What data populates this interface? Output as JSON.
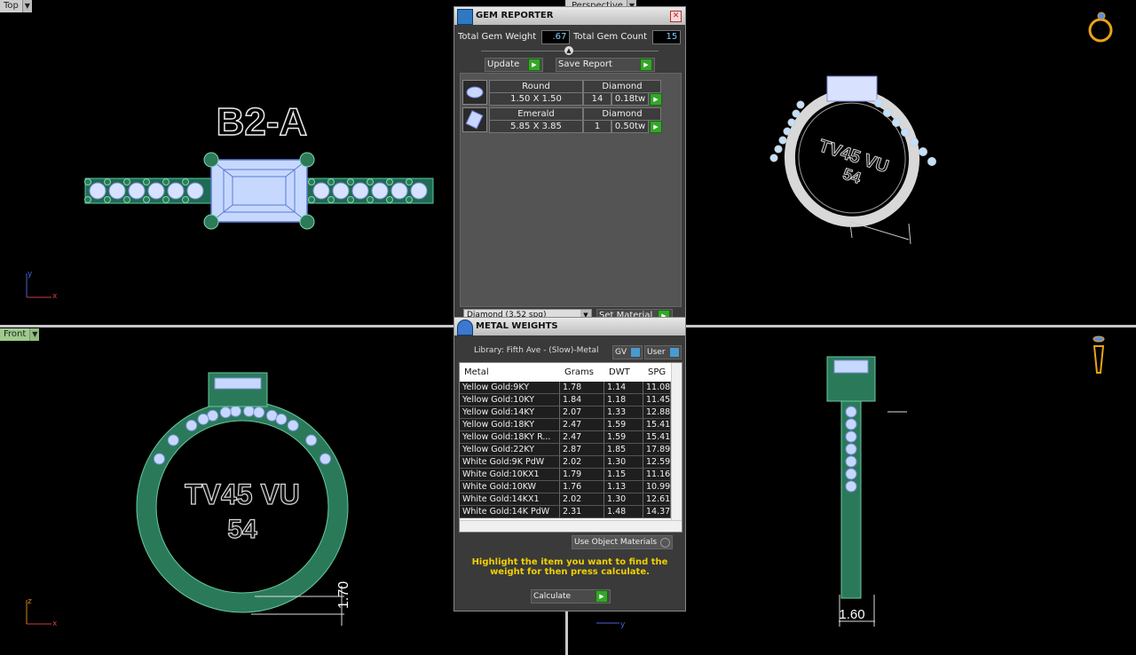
{
  "viewports": {
    "top": {
      "label": "Top",
      "ring_text": "B2-A"
    },
    "perspective": {
      "label": "Perspective",
      "inscription_1": "TV45 VU",
      "inscription_2": "54"
    },
    "front": {
      "label": "Front",
      "inscription_1": "TV45 VU",
      "inscription_2": "54",
      "dimension": "1.70"
    },
    "right": {
      "dimension": "1.60"
    }
  },
  "axis": {
    "x": "x",
    "y": "y",
    "z": "z"
  },
  "gem_reporter": {
    "title": "GEM REPORTER",
    "total_weight_label": "Total Gem Weight",
    "total_weight_value": ".67",
    "total_count_label": "Total Gem Count",
    "total_count_value": "15",
    "update_label": "Update",
    "save_report_label": "Save Report",
    "gems": [
      {
        "cut": "Round",
        "material": "Diamond",
        "size": "1.50 X 1.50",
        "count": "14",
        "weight": "0.18tw"
      },
      {
        "cut": "Emerald",
        "material": "Diamond",
        "size": "5.85 X 3.85",
        "count": "1",
        "weight": "0.50tw"
      }
    ],
    "material_select": "Diamond    (3.52 spg)",
    "set_material_label": "Set Material"
  },
  "metal_weights": {
    "title": "METAL WEIGHTS",
    "library": "Library: Fifth Ave - (Slow)-Metal",
    "gv_label": "GV",
    "user_label": "User",
    "columns": [
      "Metal",
      "Grams",
      "DWT",
      "SPG"
    ],
    "rows": [
      [
        "Yellow Gold:9KY",
        "1.78",
        "1.14",
        "11.08"
      ],
      [
        "Yellow Gold:10KY",
        "1.84",
        "1.18",
        "11.45"
      ],
      [
        "Yellow Gold:14KY",
        "2.07",
        "1.33",
        "12.88"
      ],
      [
        "Yellow Gold:18KY",
        "2.47",
        "1.59",
        "15.41"
      ],
      [
        "Yellow Gold:18KY R...",
        "2.47",
        "1.59",
        "15.41"
      ],
      [
        "Yellow Gold:22KY",
        "2.87",
        "1.85",
        "17.89"
      ],
      [
        "White Gold:9K PdW",
        "2.02",
        "1.30",
        "12.59"
      ],
      [
        "White Gold:10KX1",
        "1.79",
        "1.15",
        "11.16"
      ],
      [
        "White Gold:10KW",
        "1.76",
        "1.13",
        "10.99"
      ],
      [
        "White Gold:14KX1",
        "2.02",
        "1.30",
        "12.61"
      ],
      [
        "White Gold:14K PdW",
        "2.31",
        "1.48",
        "14.37"
      ]
    ],
    "use_object_materials": "Use Object Materials",
    "instruction": "Highlight the item you want to find the weight for then press calculate.",
    "calculate_label": "Calculate"
  }
}
